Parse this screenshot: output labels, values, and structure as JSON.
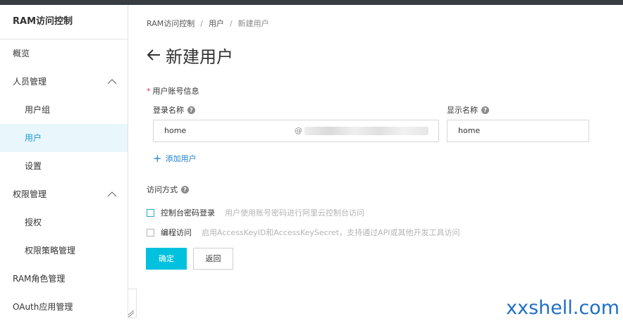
{
  "sidebar": {
    "title": "RAM访问控制",
    "items": [
      {
        "label": "概览"
      },
      {
        "label": "人员管理"
      },
      {
        "label": "用户组"
      },
      {
        "label": "用户"
      },
      {
        "label": "设置"
      },
      {
        "label": "权限管理"
      },
      {
        "label": "授权"
      },
      {
        "label": "权限策略管理"
      },
      {
        "label": "RAM角色管理"
      },
      {
        "label": "OAuth应用管理"
      }
    ]
  },
  "breadcrumb": [
    "RAM访问控制",
    "用户",
    "新建用户"
  ],
  "breadcrumb_separator": "/",
  "page_title": "新建用户",
  "form": {
    "account_section_label": "用户账号信息",
    "required_mark": "*",
    "login_name_label": "登录名称",
    "login_name_value": "home",
    "login_domain_at": "@",
    "display_name_label": "显示名称",
    "display_name_value": "home",
    "help_glyph": "?",
    "add_user_plus": "+",
    "add_user_label": "添加用户",
    "access_label": "访问方式",
    "console_login_label": "控制台密码登录",
    "console_login_hint": "用户使用账号密码进行阿里云控制台访问",
    "programmatic_label": "编程访问",
    "programmatic_hint": "启用AccessKeyID和AccessKeySecret，支持通过API或其他开发工具访问",
    "ok_button": "确定",
    "back_button": "返回"
  },
  "watermark": "xxshell.com",
  "colors": {
    "accent": "#00c1de",
    "link": "#1e7fc9",
    "active_bg": "#e9f6fb",
    "required": "#e4393c"
  }
}
